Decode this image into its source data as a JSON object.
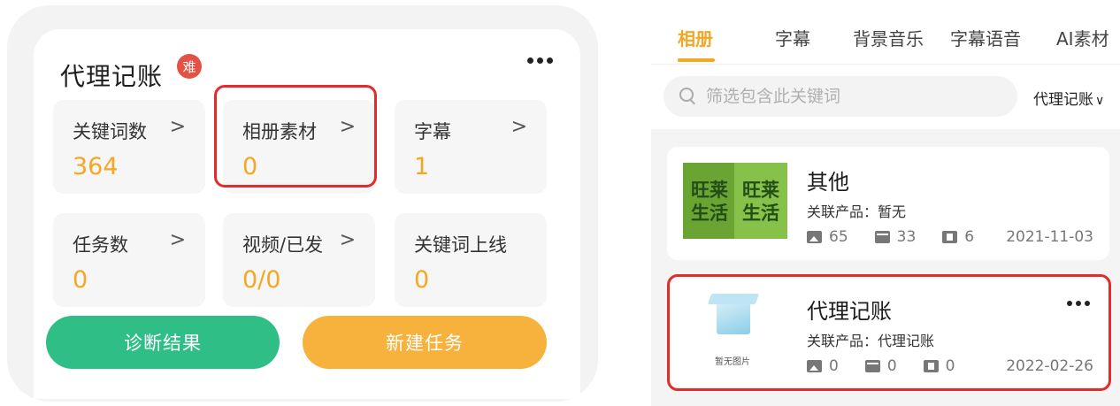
{
  "left_card": {
    "title": "代理记账",
    "badge": "难",
    "stats": [
      {
        "label": "关键词数",
        "value": "364"
      },
      {
        "label": "相册素材",
        "value": "0"
      },
      {
        "label": "字幕",
        "value": "1"
      },
      {
        "label": "任务数",
        "value": "0"
      },
      {
        "label": "视频/已发",
        "value": "0/0"
      },
      {
        "label": "关键词上线",
        "value": "0"
      }
    ],
    "chevron": ">",
    "diagnose_button": "诊断结果",
    "new_task_button": "新建任务"
  },
  "right_panel": {
    "tabs": [
      "相册",
      "字幕",
      "背景音乐",
      "字幕语音",
      "AI素材"
    ],
    "active_tab": "相册",
    "search_placeholder": "筛选包含此关键词",
    "filter_label": "代理记账",
    "filter_caret": "∨",
    "items": [
      {
        "title": "其他",
        "related": "关联产品：暂无",
        "images": "65",
        "clips": "33",
        "videos": "6",
        "date": "2021-11-03",
        "thumb_text_1": "旺莱生活",
        "thumb_text_2": "旺莱生活"
      },
      {
        "title": "代理记账",
        "related": "关联产品：代理记账",
        "images": "0",
        "clips": "0",
        "videos": "0",
        "date": "2022-02-26",
        "thumb_caption": "暂无图片"
      }
    ]
  },
  "colors": {
    "accent": "#f5a623",
    "green_button": "#2fbf86",
    "orange_button": "#f6b23c",
    "highlight": "#e42b2b",
    "badge": "#e35245"
  }
}
